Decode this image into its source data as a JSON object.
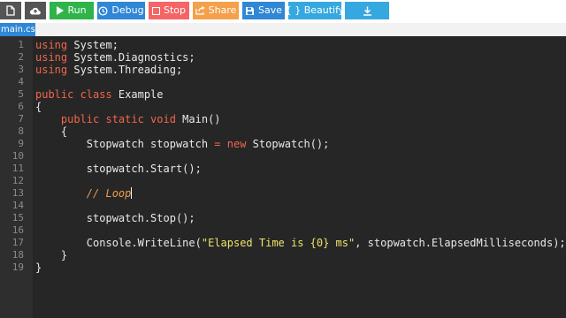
{
  "toolbar": {
    "buttons": [
      {
        "name": "file-menu-button",
        "icon": "file-icon",
        "label": "",
        "color": "#555555"
      },
      {
        "name": "upload-button",
        "icon": "cloud-upload-icon",
        "label": "",
        "color": "#555555"
      },
      {
        "name": "run-button",
        "icon": "play-icon",
        "label": "Run",
        "color": "#2fb44a"
      },
      {
        "name": "debug-button",
        "icon": "gear-icon",
        "label": "Debug",
        "color": "#2f87d6"
      },
      {
        "name": "stop-button",
        "icon": "stop-icon",
        "label": "Stop",
        "color": "#f56565"
      },
      {
        "name": "share-button",
        "icon": "share-icon",
        "label": "Share",
        "color": "#f5a04a"
      },
      {
        "name": "save-button",
        "icon": "save-icon",
        "label": "Save",
        "color": "#2f87d6"
      },
      {
        "name": "beautify-button",
        "icon": "braces-icon",
        "label": "{ } Beautify",
        "color": "#35a8e0"
      },
      {
        "name": "download-button",
        "icon": "download-icon",
        "label": "",
        "color": "#35a8e0"
      }
    ]
  },
  "tabs": [
    {
      "label": "main.cs",
      "active": true
    }
  ],
  "editor": {
    "lines": [
      {
        "num": "1",
        "tokens": [
          {
            "t": "kw",
            "v": "using"
          },
          {
            "t": "plain",
            "v": " System;"
          }
        ]
      },
      {
        "num": "2",
        "tokens": [
          {
            "t": "kw",
            "v": "using"
          },
          {
            "t": "plain",
            "v": " System.Diagnostics;"
          }
        ]
      },
      {
        "num": "3",
        "tokens": [
          {
            "t": "kw",
            "v": "using"
          },
          {
            "t": "plain",
            "v": " System.Threading;"
          }
        ]
      },
      {
        "num": "4",
        "tokens": []
      },
      {
        "num": "5",
        "tokens": [
          {
            "t": "kw",
            "v": "public class"
          },
          {
            "t": "plain",
            "v": " Example"
          }
        ]
      },
      {
        "num": "6",
        "tokens": [
          {
            "t": "plain",
            "v": "{"
          }
        ]
      },
      {
        "num": "7",
        "tokens": [
          {
            "t": "plain",
            "v": "    "
          },
          {
            "t": "kw",
            "v": "public static void"
          },
          {
            "t": "plain",
            "v": " Main()"
          }
        ]
      },
      {
        "num": "8",
        "tokens": [
          {
            "t": "plain",
            "v": "    {"
          }
        ]
      },
      {
        "num": "9",
        "tokens": [
          {
            "t": "plain",
            "v": "        Stopwatch stopwatch "
          },
          {
            "t": "kw",
            "v": "="
          },
          {
            "t": "plain",
            "v": " "
          },
          {
            "t": "kw",
            "v": "new"
          },
          {
            "t": "plain",
            "v": " Stopwatch();"
          }
        ]
      },
      {
        "num": "10",
        "tokens": []
      },
      {
        "num": "11",
        "tokens": [
          {
            "t": "plain",
            "v": "        stopwatch.Start();"
          }
        ]
      },
      {
        "num": "12",
        "tokens": []
      },
      {
        "num": "13",
        "tokens": [
          {
            "t": "plain",
            "v": "        "
          },
          {
            "t": "cmt",
            "v": "// Loop"
          }
        ],
        "caret": true
      },
      {
        "num": "14",
        "tokens": []
      },
      {
        "num": "15",
        "tokens": [
          {
            "t": "plain",
            "v": "        stopwatch.Stop();"
          }
        ]
      },
      {
        "num": "16",
        "tokens": []
      },
      {
        "num": "17",
        "tokens": [
          {
            "t": "plain",
            "v": "        Console.WriteLine("
          },
          {
            "t": "str",
            "v": "\"Elapsed Time is {0} ms\""
          },
          {
            "t": "plain",
            "v": ", stopwatch.ElapsedMilliseconds);"
          }
        ]
      },
      {
        "num": "18",
        "tokens": [
          {
            "t": "plain",
            "v": "    }"
          }
        ]
      },
      {
        "num": "19",
        "tokens": [
          {
            "t": "plain",
            "v": "}"
          }
        ]
      }
    ]
  }
}
